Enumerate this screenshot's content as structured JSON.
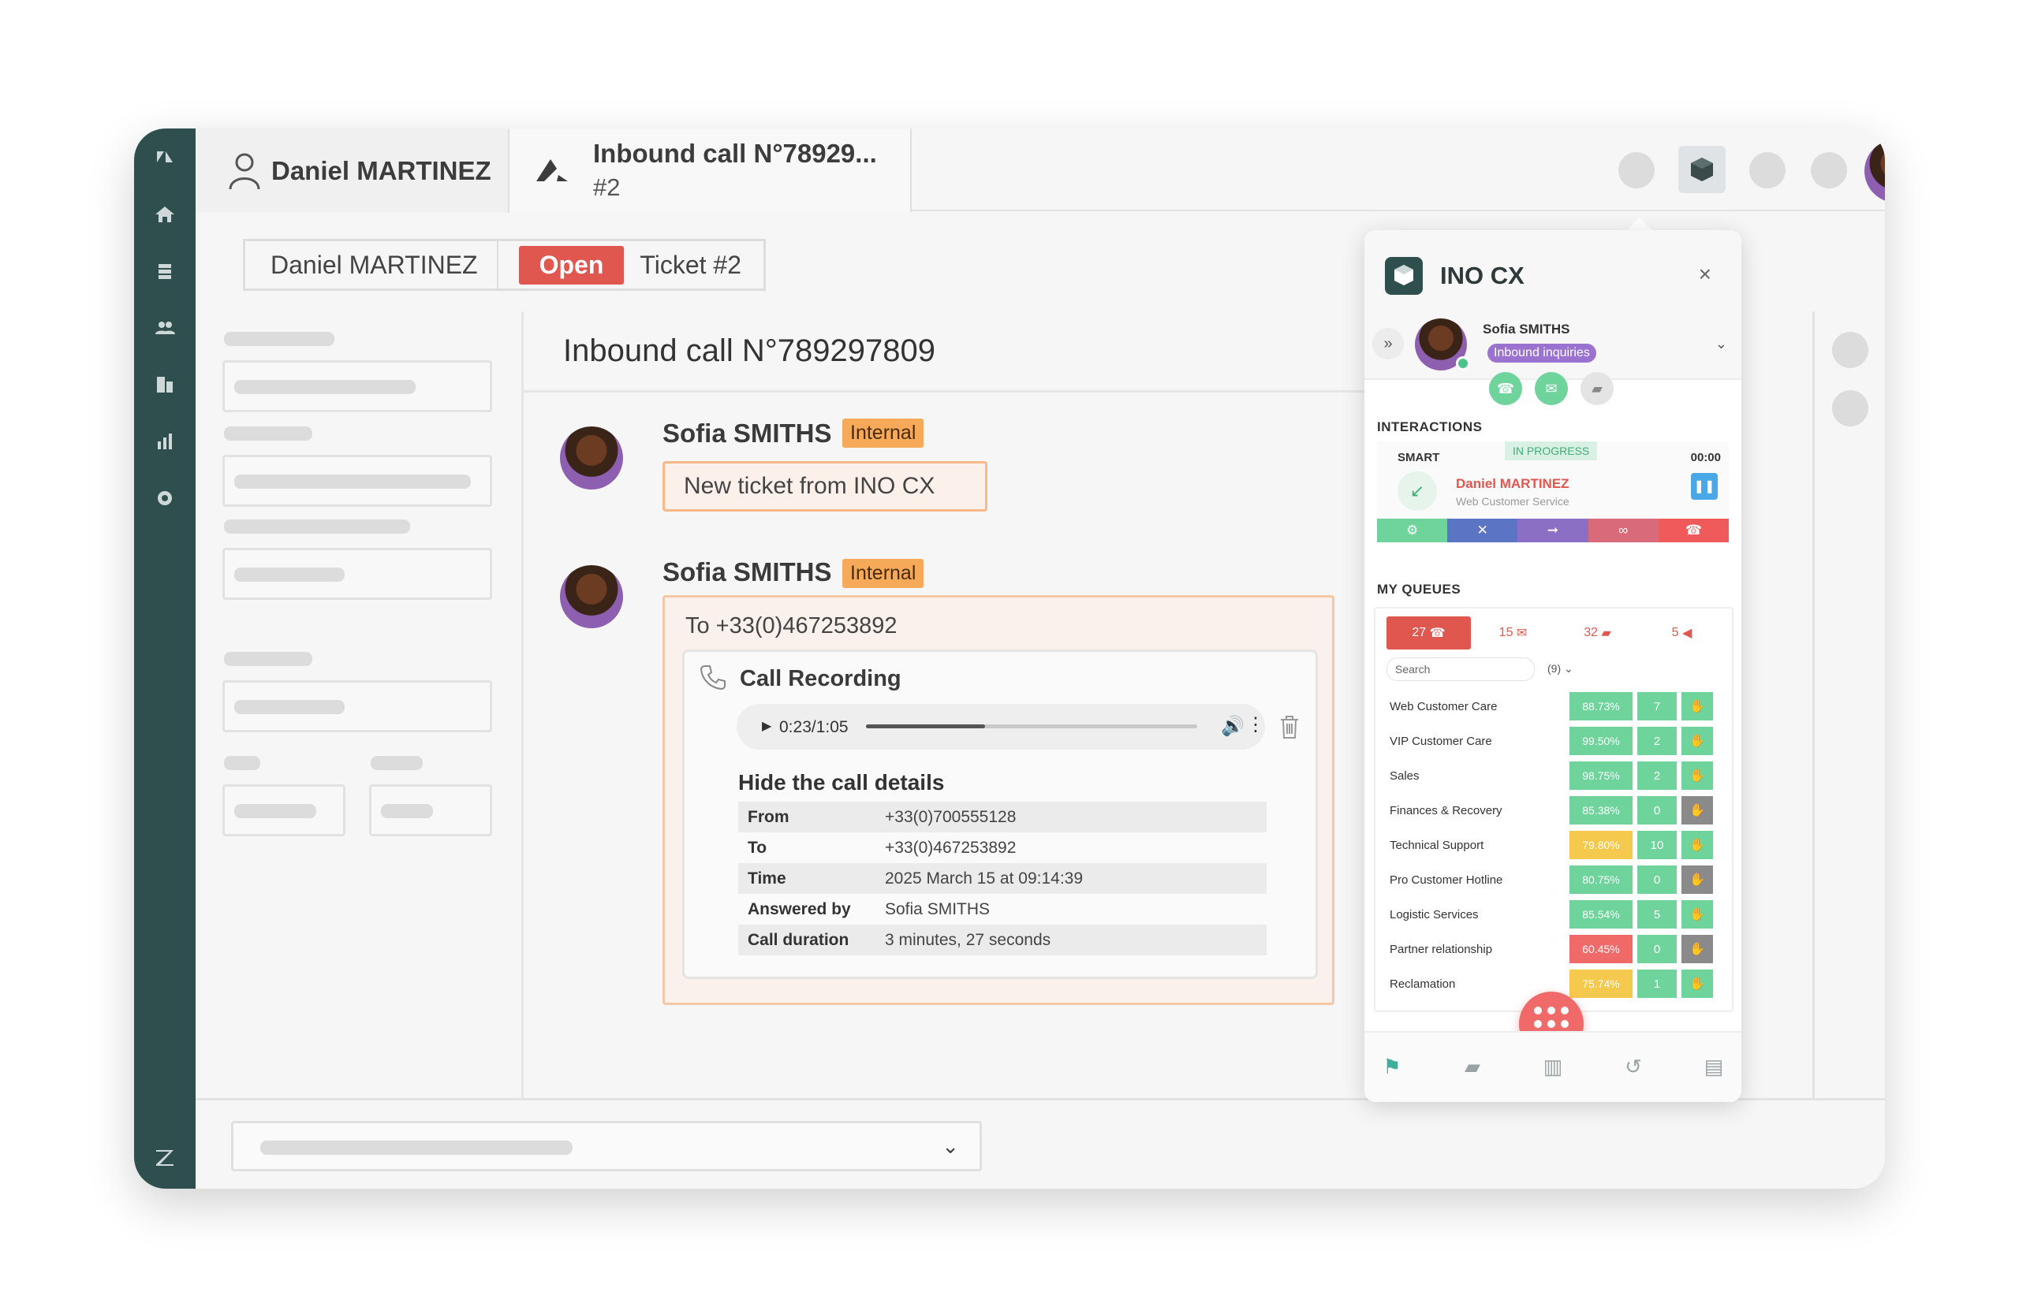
{
  "app": {
    "tab_user": "Daniel MARTINEZ",
    "tab_call_title": "Inbound call N°78929...",
    "tab_call_sub": "#2"
  },
  "ticket": {
    "requester": "Daniel MARTINEZ",
    "status": "Open",
    "ticket_label": "Ticket #2",
    "title": "Inbound call N°789297809"
  },
  "messages": [
    {
      "author": "Sofia SMITHS",
      "badge": "Internal",
      "text": "New ticket from INO CX"
    },
    {
      "author": "Sofia SMITHS",
      "badge": "Internal",
      "to": "To +33(0)467253892",
      "recording_title": "Call Recording",
      "player_time": "0:23/1:05",
      "player_progress": 0.36,
      "details_title": "Hide the call details",
      "details": [
        {
          "key": "From",
          "value": "+33(0)700555128"
        },
        {
          "key": "To",
          "value": "+33(0)467253892"
        },
        {
          "key": "Time",
          "value": "2025 March 15 at 09:14:39"
        },
        {
          "key": "Answered by",
          "value": "Sofia SMITHS"
        },
        {
          "key": "Call duration",
          "value": "3 minutes, 27 seconds"
        }
      ]
    }
  ],
  "widget": {
    "title": "INO CX",
    "close_icon": "×",
    "agent_name": "Sofia SMITHS",
    "agent_status": "Inbound inquiries",
    "interactions_title": "INTERACTIONS",
    "interaction": {
      "type": "SMART",
      "state": "IN PROGRESS",
      "timer": "00:00",
      "caller": "Daniel MARTINEZ",
      "service": "Web Customer Service"
    },
    "queues_title": "MY QUEUES",
    "queue_tabs": [
      {
        "count": "27",
        "icon": "phone-icon",
        "glyph": "☎"
      },
      {
        "count": "15",
        "icon": "mail-icon",
        "glyph": "✉"
      },
      {
        "count": "32",
        "icon": "chat-icon",
        "glyph": "▰"
      },
      {
        "count": "5",
        "icon": "megaphone-icon",
        "glyph": "◀"
      }
    ],
    "search_placeholder": "Search",
    "queue_count": "(9)",
    "queues": [
      {
        "name": "Web Customer Care",
        "pct": "88.73%",
        "num": "7",
        "level": "green",
        "hand": "green"
      },
      {
        "name": "VIP Customer Care",
        "pct": "99.50%",
        "num": "2",
        "level": "green",
        "hand": "green"
      },
      {
        "name": "Sales",
        "pct": "98.75%",
        "num": "2",
        "level": "green",
        "hand": "green"
      },
      {
        "name": "Finances & Recovery",
        "pct": "85.38%",
        "num": "0",
        "level": "green",
        "hand": "grey"
      },
      {
        "name": "Technical Support",
        "pct": "79.80%",
        "num": "10",
        "level": "yellow",
        "hand": "green"
      },
      {
        "name": "Pro Customer Hotline",
        "pct": "80.75%",
        "num": "0",
        "level": "green",
        "hand": "grey"
      },
      {
        "name": "Logistic Services",
        "pct": "85.54%",
        "num": "5",
        "level": "green",
        "hand": "green"
      },
      {
        "name": "Partner relationship",
        "pct": "60.45%",
        "num": "0",
        "level": "red",
        "hand": "grey"
      },
      {
        "name": "Reclamation",
        "pct": "75.74%",
        "num": "1",
        "level": "yellow",
        "hand": "green"
      }
    ]
  },
  "colors": {
    "sidebar": "#2f4f4f",
    "accent_red": "#e0574f",
    "internal_badge": "#f7a95a",
    "green": "#6fd39c",
    "yellow": "#f5c94d",
    "red": "#f06a6a",
    "grey": "#8a8a8a",
    "purple": "#9b72cf"
  }
}
